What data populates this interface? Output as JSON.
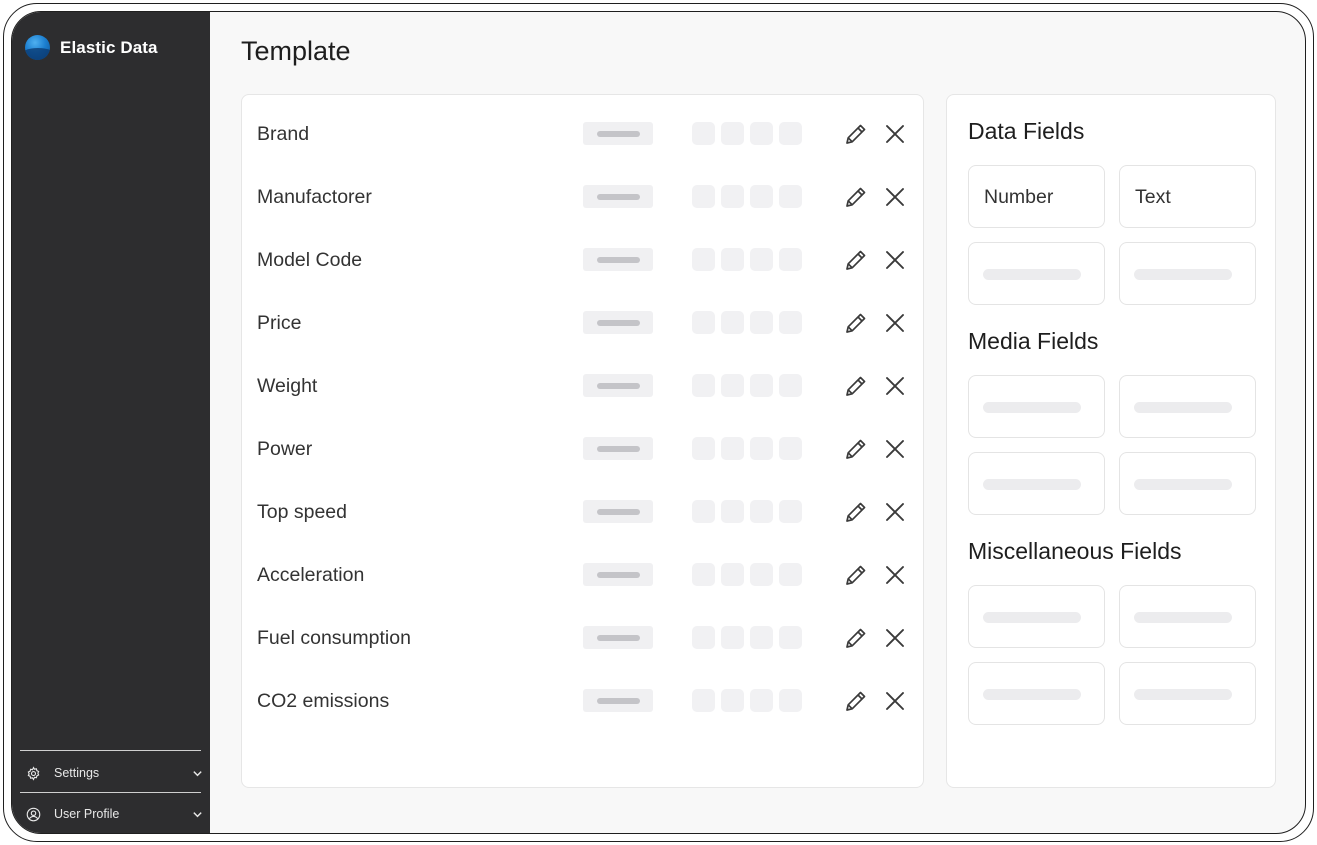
{
  "app": {
    "name": "Elastic Data"
  },
  "sidebar": {
    "items": [
      {
        "label": "Settings",
        "icon": "gear-icon"
      },
      {
        "label": "User Profile",
        "icon": "user-circle-icon"
      }
    ]
  },
  "page": {
    "title": "Template"
  },
  "fields": [
    {
      "label": "Brand"
    },
    {
      "label": "Manufactorer"
    },
    {
      "label": "Model Code"
    },
    {
      "label": "Price"
    },
    {
      "label": "Weight"
    },
    {
      "label": "Power"
    },
    {
      "label": "Top speed"
    },
    {
      "label": "Acceleration"
    },
    {
      "label": "Fuel consumption"
    },
    {
      "label": "CO2 emissions"
    }
  ],
  "palette": {
    "sections": [
      {
        "title": "Data Fields",
        "tiles": [
          "Number",
          "Text",
          "",
          ""
        ]
      },
      {
        "title": "Media Fields",
        "tiles": [
          "",
          "",
          "",
          ""
        ]
      },
      {
        "title": "Miscellaneous Fields",
        "tiles": [
          "",
          "",
          "",
          ""
        ]
      }
    ]
  },
  "colors": {
    "sidebar_bg": "#2d2d2f",
    "page_bg": "#f8f8f8",
    "card_bg": "#ffffff",
    "logo_blue": "#1c7fd0"
  }
}
